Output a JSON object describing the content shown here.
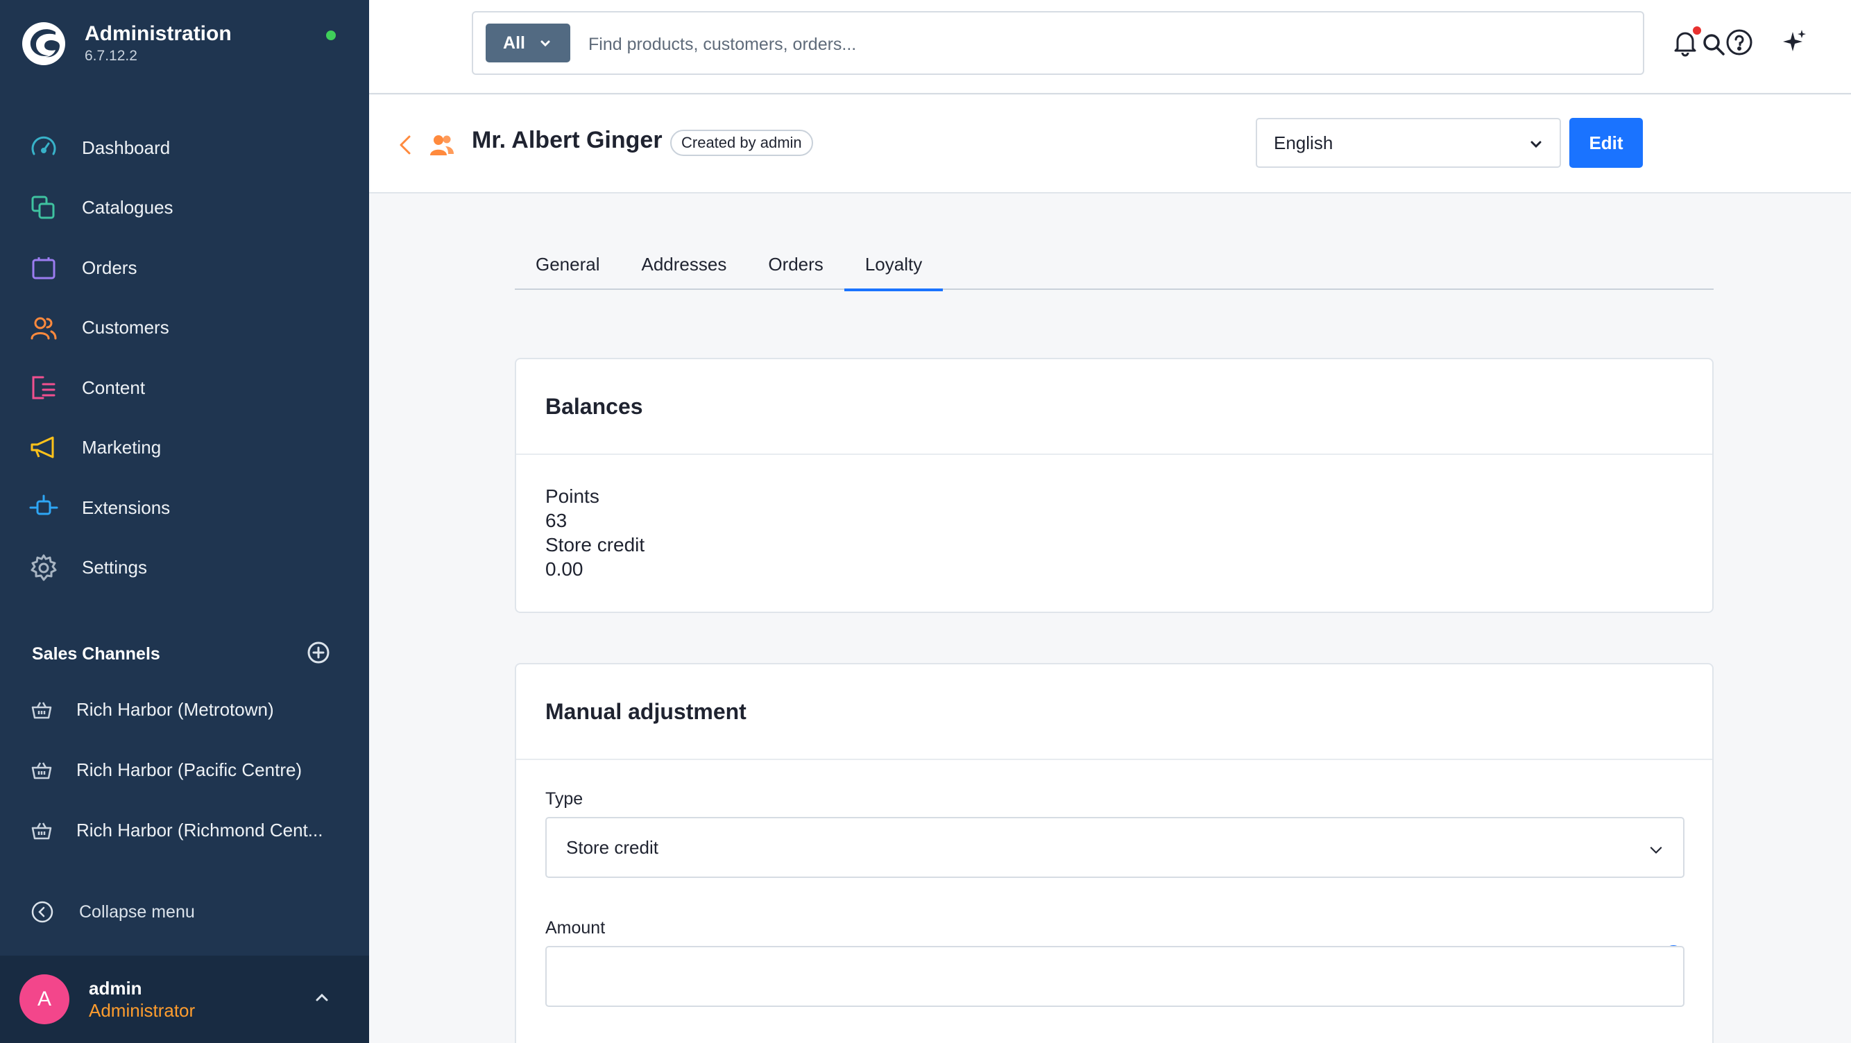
{
  "app": {
    "title": "Administration",
    "version": "6.7.12.2"
  },
  "sidebar": {
    "items": [
      {
        "label": "Dashboard",
        "icon": "dashboard-icon",
        "color": "#38b2c9"
      },
      {
        "label": "Catalogues",
        "icon": "catalogues-icon",
        "color": "#3fc2a0"
      },
      {
        "label": "Orders",
        "icon": "orders-icon",
        "color": "#9b7cf0"
      },
      {
        "label": "Customers",
        "icon": "customers-icon",
        "color": "#ff8a3d"
      },
      {
        "label": "Content",
        "icon": "content-icon",
        "color": "#f0508f"
      },
      {
        "label": "Marketing",
        "icon": "marketing-icon",
        "color": "#ffc21a"
      },
      {
        "label": "Extensions",
        "icon": "extensions-icon",
        "color": "#2ea6f5"
      },
      {
        "label": "Settings",
        "icon": "settings-icon",
        "color": "#a7b4c2"
      }
    ],
    "sales_channels": {
      "title": "Sales Channels",
      "items": [
        {
          "label": "Rich Harbor (Metrotown)"
        },
        {
          "label": "Rich Harbor (Pacific Centre)"
        },
        {
          "label": "Rich Harbor (Richmond Cent..."
        }
      ]
    },
    "collapse_label": "Collapse menu",
    "user": {
      "initial": "A",
      "name": "admin",
      "role": "Administrator"
    }
  },
  "topbar": {
    "search_scope": "All",
    "search_placeholder": "Find products, customers, orders..."
  },
  "page": {
    "title": "Mr. Albert Ginger",
    "badge": "Created by admin",
    "language": "English",
    "edit_label": "Edit"
  },
  "tabs": [
    {
      "label": "General",
      "active": false
    },
    {
      "label": "Addresses",
      "active": false
    },
    {
      "label": "Orders",
      "active": false
    },
    {
      "label": "Loyalty",
      "active": true
    }
  ],
  "balances": {
    "title": "Balances",
    "points_label": "Points",
    "points_value": "63",
    "store_credit_label": "Store credit",
    "store_credit_value": "0.00"
  },
  "manual_adjustment": {
    "title": "Manual adjustment",
    "type_label": "Type",
    "type_value": "Store credit",
    "amount_label": "Amount",
    "amount_value": ""
  },
  "colors": {
    "sidebar_bg": "#1f3550",
    "accent": "#1a73ff",
    "role_color": "#ff9d2e",
    "avatar_bg": "#f3468b",
    "status_online": "#3fcf5a"
  }
}
